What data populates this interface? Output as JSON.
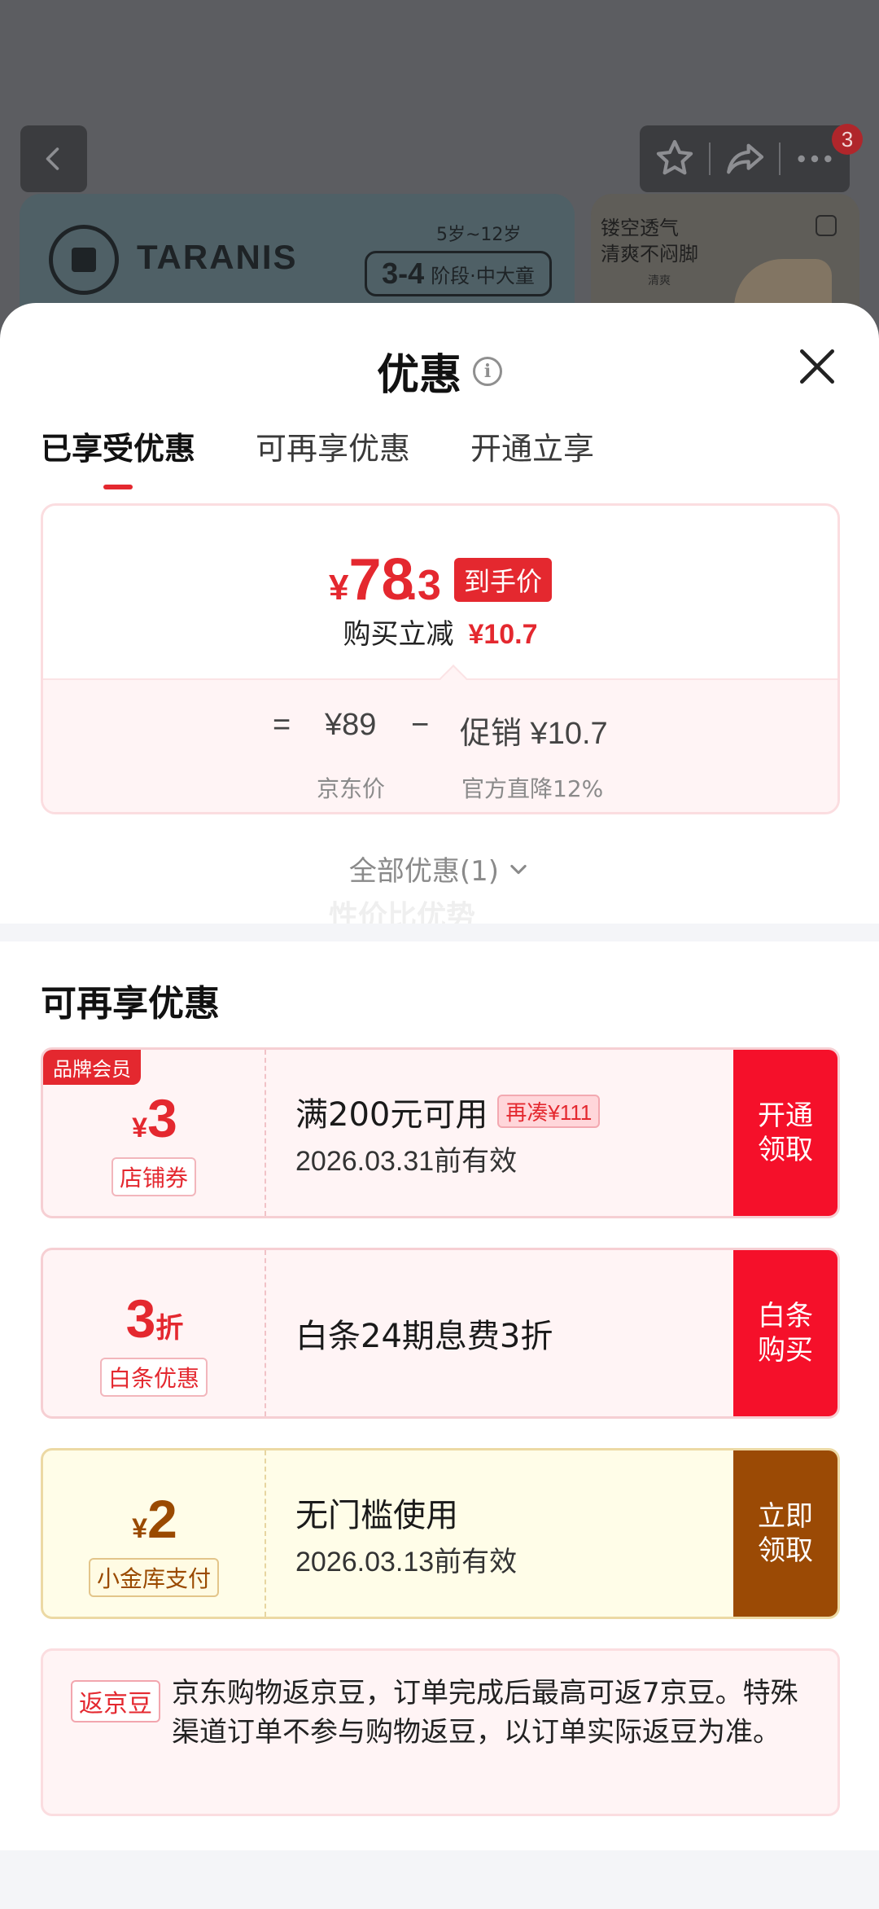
{
  "background": {
    "badge_count": "3",
    "brand_name": "TARANIS",
    "age_range": "5岁~12岁",
    "stage_big": "3-4",
    "stage_small": "阶段·中大童",
    "right_line1": "镂空透气",
    "right_line2": "清爽不闷脚",
    "right_tag": "清爽"
  },
  "sheet": {
    "title": "优惠",
    "info_icon": "i",
    "tabs": [
      "已享受优惠",
      "可再享优惠",
      "开通立享"
    ],
    "price": {
      "currency": "¥",
      "integer": "78",
      "decimal": ".3",
      "tag": "到手价",
      "reduce_label": "购买立减",
      "reduce_value": "¥10.7",
      "eq": "=",
      "jd_price": "¥89",
      "minus": "−",
      "promo_label": "促销 ¥10.7",
      "jd_price_label": "京东价",
      "promo_sub": "官方直降12%"
    },
    "all_promos": "全部优惠(1)",
    "watermark": "性价比优势",
    "section_title": "可再享优惠",
    "coupons": [
      {
        "member_tag": "品牌会员",
        "currency": "¥",
        "amount": "3",
        "suffix": "",
        "type": "店铺券",
        "condition": "满200元可用",
        "extra": "再凑¥111",
        "date": "2026.03.31前有效",
        "button": "开通领取"
      },
      {
        "currency": "",
        "amount": "3",
        "suffix": "折",
        "type": "白条优惠",
        "condition": "白条24期息费3折",
        "button": "白条购买"
      },
      {
        "currency": "¥",
        "amount": "2",
        "suffix": "",
        "type": "小金库支付",
        "condition": "无门槛使用",
        "date": "2026.03.13前有效",
        "button": "立即领取"
      }
    ],
    "bean": {
      "tag": "返京豆",
      "text": "京东购物返京豆，订单完成后最高可返7京豆。特殊渠道订单不参与购物返豆，以订单实际返豆为准。"
    }
  },
  "colors": {
    "accent": "#e4282f",
    "gold": "#9b4a05"
  }
}
